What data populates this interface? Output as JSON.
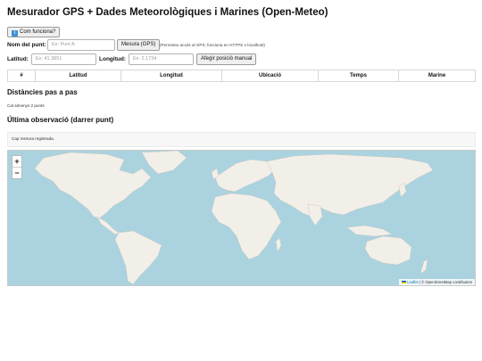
{
  "page": {
    "title": "Mesurador GPS + Dades Meteorològiques i Marines (Open-Meteo)"
  },
  "help": {
    "label": "Com funciona?"
  },
  "point_name": {
    "label": "Nom del punt:",
    "placeholder": "Ex: Punt A",
    "measure_label": "Mesura (GPS)",
    "note": "(Permeteu accés al GPS; funciona en HTTPS o localhost)"
  },
  "coords": {
    "lat_label": "Latitud:",
    "lat_placeholder": "Ex: 41.3851",
    "lon_label": "Longitud:",
    "lon_placeholder": "Ex: 2.1734",
    "add_label": "Afegir posició manual"
  },
  "table": {
    "columns": [
      "#",
      "Latitud",
      "Longitud",
      "Ubicació",
      "Temps",
      "Marine"
    ]
  },
  "distances": {
    "heading": "Distàncies pas a pas",
    "message": "Cal almenys 2 punts"
  },
  "observation": {
    "heading": "Última observació (darrer punt)",
    "message": "Cap mesura registrada."
  },
  "map": {
    "zoom_in": "+",
    "zoom_out": "−",
    "attr_leaflet": "Leaflet",
    "attr_rest": "| © OpenStreetMap contributors",
    "ocean_color": "#aad3df",
    "land_color": "#f2efe9"
  }
}
